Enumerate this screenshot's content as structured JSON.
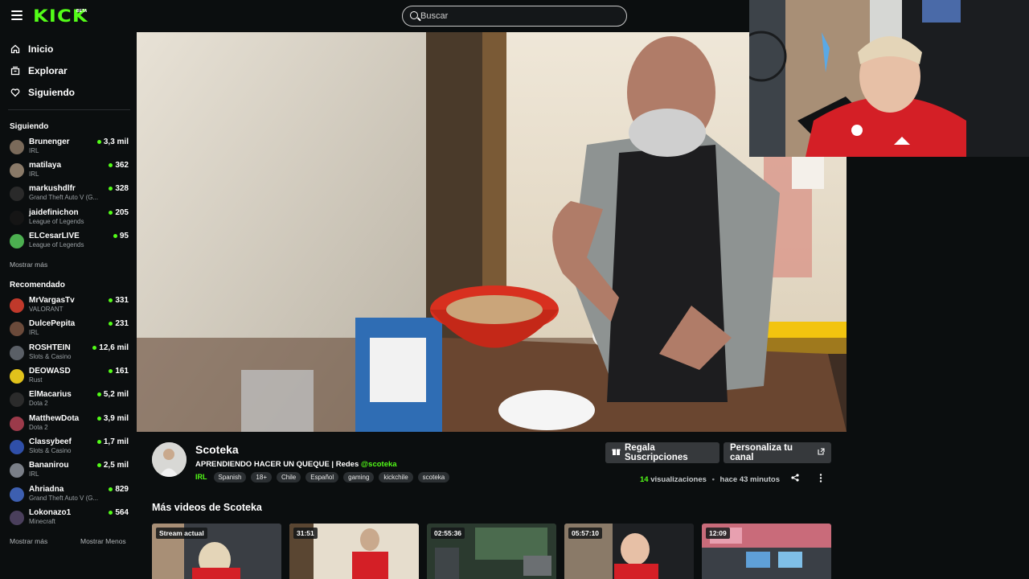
{
  "header": {
    "logo_text": "KICK",
    "logo_badge": "BETA",
    "search_placeholder": "Buscar"
  },
  "sidebar": {
    "nav": [
      {
        "label": "Inicio",
        "icon": "home-icon"
      },
      {
        "label": "Explorar",
        "icon": "browse-icon"
      },
      {
        "label": "Siguiendo",
        "icon": "heart-icon"
      }
    ],
    "following_title": "Siguiendo",
    "following": [
      {
        "name": "Brunenger",
        "category": "IRL",
        "viewers": "3,3 mil"
      },
      {
        "name": "matilaya",
        "category": "IRL",
        "viewers": "362"
      },
      {
        "name": "markushdlfr",
        "category": "Grand Theft Auto V (G...",
        "viewers": "328"
      },
      {
        "name": "jaidefinichon",
        "category": "League of Legends",
        "viewers": "205"
      },
      {
        "name": "ELCesarLIVE",
        "category": "League of Legends",
        "viewers": "95"
      }
    ],
    "following_more": "Mostrar más",
    "recommended_title": "Recomendado",
    "recommended": [
      {
        "name": "MrVargasTv",
        "category": "VALORANT",
        "viewers": "331"
      },
      {
        "name": "DulcePepita",
        "category": "IRL",
        "viewers": "231"
      },
      {
        "name": "ROSHTEIN",
        "category": "Slots & Casino",
        "viewers": "12,6 mil"
      },
      {
        "name": "DEOWASD",
        "category": "Rust",
        "viewers": "161"
      },
      {
        "name": "ElMacarius",
        "category": "Dota 2",
        "viewers": "5,2 mil"
      },
      {
        "name": "MatthewDota",
        "category": "Dota 2",
        "viewers": "3,9 mil"
      },
      {
        "name": "Classybeef",
        "category": "Slots & Casino",
        "viewers": "1,7 mil"
      },
      {
        "name": "Bananirou",
        "category": "IRL",
        "viewers": "2,5 mil"
      },
      {
        "name": "Ahriadna",
        "category": "Grand Theft Auto V (G...",
        "viewers": "829"
      },
      {
        "name": "Lokonazo1",
        "category": "Minecraft",
        "viewers": "564"
      }
    ],
    "recommended_more": "Mostrar más",
    "recommended_less": "Mostrar Menos"
  },
  "stream": {
    "streamer": "Scoteka",
    "title": "APRENDIENDO HACER UN QUEQUE | Redes ",
    "mention": "@scoteka",
    "category": "IRL",
    "tags": [
      "Spanish",
      "18+",
      "Chile",
      "Español",
      "gaming",
      "kickchile",
      "scoteka"
    ],
    "gift_button": "Regala Suscripciones",
    "customize_button": "Personaliza tu canal",
    "views_count": "14",
    "views_label": "visualizaciones",
    "separator": "•",
    "time_ago": "hace 43 minutos"
  },
  "more_videos": {
    "title": "Más videos de Scoteka",
    "items": [
      {
        "badge": "Stream actual"
      },
      {
        "badge": "31:51"
      },
      {
        "badge": "02:55:36"
      },
      {
        "badge": "05:57:10"
      },
      {
        "badge": "12:09"
      }
    ]
  },
  "colors": {
    "accent": "#53fc18",
    "background": "#0b0e0f",
    "button": "#36393c"
  }
}
